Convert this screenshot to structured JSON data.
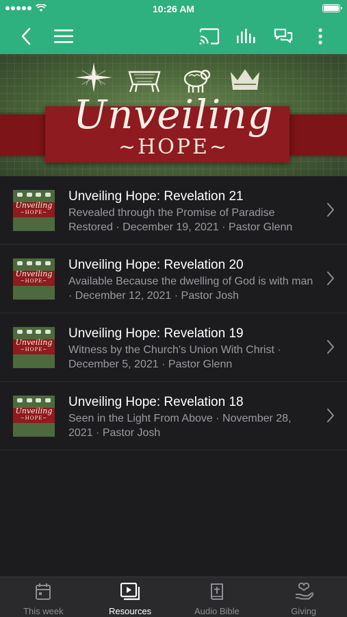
{
  "status_bar": {
    "time": "10:26 AM"
  },
  "banner": {
    "script_text": "Unveiling",
    "sub_text": "~HOPE~"
  },
  "sermons": [
    {
      "title": "Unveiling Hope: Revelation 21",
      "description": "Revealed through the Promise of Paradise Restored · December 19, 2021 · Pastor Glenn"
    },
    {
      "title": "Unveiling Hope: Revelation 20",
      "description": "Available Because the dwelling of God is with man · December 12, 2021 · Pastor Josh"
    },
    {
      "title": "Unveiling Hope: Revelation 19",
      "description": "Witness by the Church's Union With Christ · December 5, 2021 · Pastor Glenn"
    },
    {
      "title": "Unveiling Hope: Revelation 18",
      "description": "Seen in the Light From Above · November 28, 2021 · Pastor Josh"
    }
  ],
  "thumb": {
    "script_text": "Unveiling",
    "sub_text": "~HOPE~"
  },
  "tabs": [
    {
      "label": "This week",
      "icon": "calendar-icon",
      "active": false
    },
    {
      "label": "Resources",
      "icon": "video-library-icon",
      "active": true
    },
    {
      "label": "Audio Bible",
      "icon": "bible-icon",
      "active": false
    },
    {
      "label": "Giving",
      "icon": "giving-hand-icon",
      "active": false
    }
  ],
  "colors": {
    "accent": "#2fb07f",
    "background": "#1c1c1e",
    "tab_bar": "#2a2a2c"
  }
}
